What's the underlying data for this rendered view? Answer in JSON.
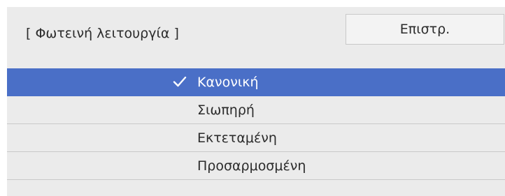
{
  "header": {
    "title": "[ Φωτεινή λειτουργία ]",
    "back_label": "Επιστρ."
  },
  "options": [
    {
      "label": "Κανονική",
      "selected": true
    },
    {
      "label": "Σιωπηρή",
      "selected": false
    },
    {
      "label": "Εκτεταμένη",
      "selected": false
    },
    {
      "label": "Προσαρμοσμένη",
      "selected": false
    }
  ],
  "colors": {
    "selected_background": "#4a6fc7",
    "panel_background": "#ebebeb",
    "button_background": "#f3f3f3"
  },
  "icons": {
    "selected_marker": "checkmark-icon"
  }
}
